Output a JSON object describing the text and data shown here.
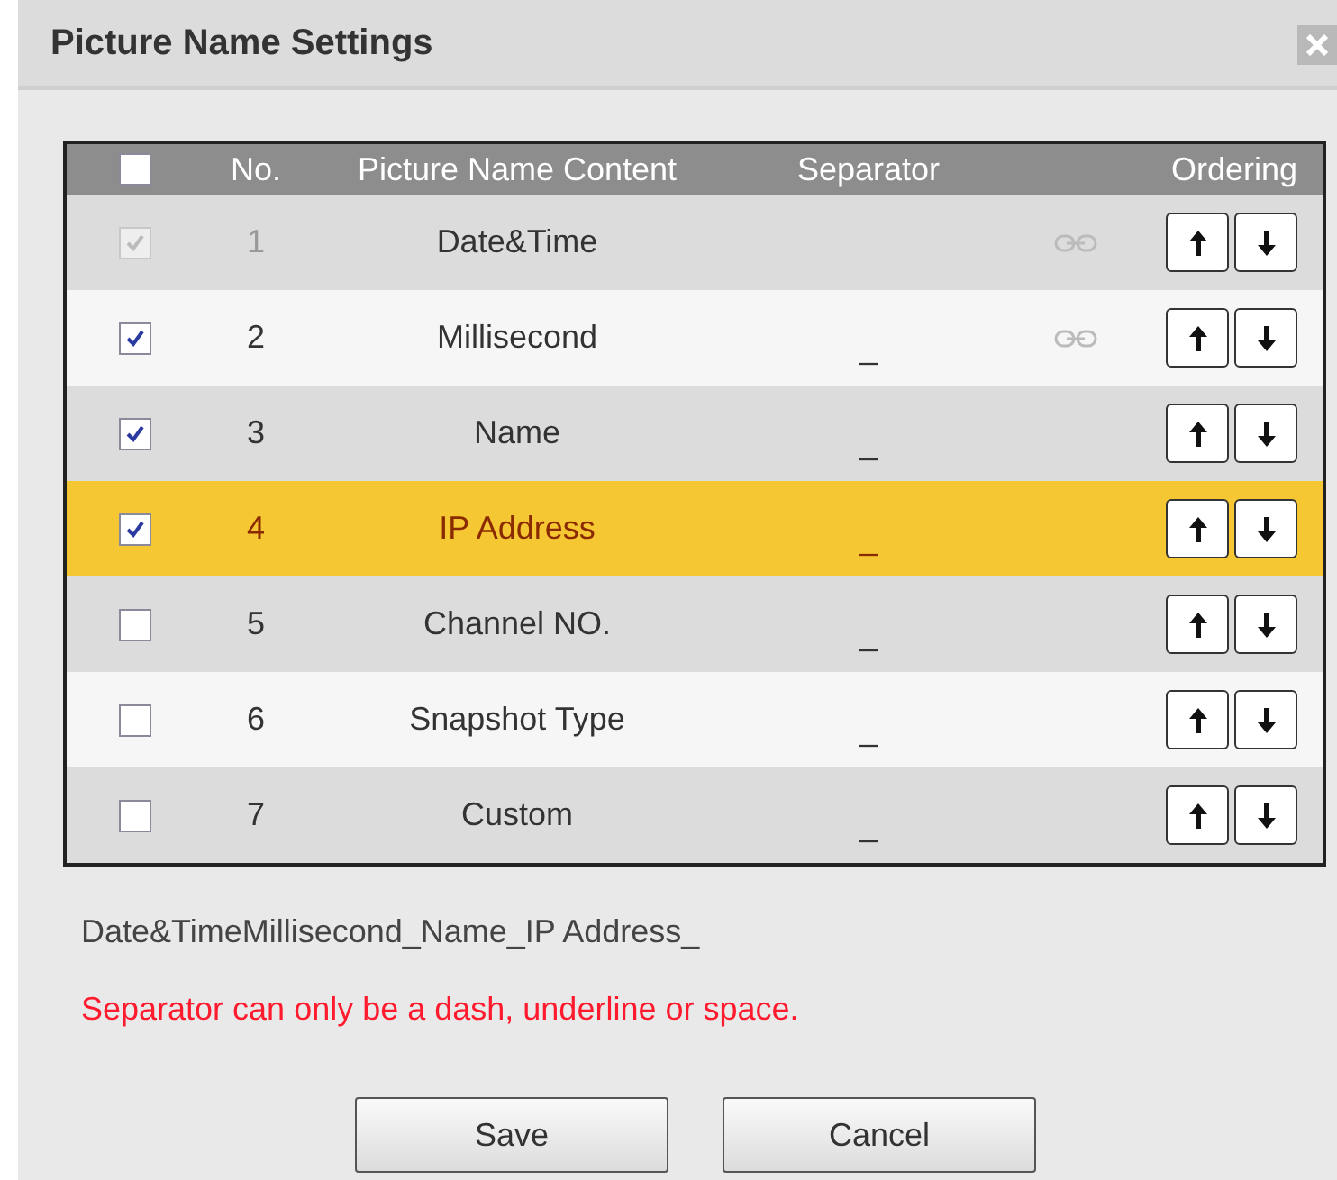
{
  "dialog": {
    "title": "Picture Name Settings"
  },
  "table": {
    "header": {
      "all_checked": false,
      "columns": [
        "No.",
        "Picture Name Content",
        "Separator",
        "Ordering"
      ]
    },
    "rows": [
      {
        "checked": true,
        "disabled": true,
        "no": "1",
        "content": "Date&Time",
        "separator": "",
        "linked": true,
        "selected": false
      },
      {
        "checked": true,
        "disabled": false,
        "no": "2",
        "content": "Millisecond",
        "separator": "_",
        "linked": true,
        "selected": false
      },
      {
        "checked": true,
        "disabled": false,
        "no": "3",
        "content": "Name",
        "separator": "_",
        "linked": false,
        "selected": false
      },
      {
        "checked": true,
        "disabled": false,
        "no": "4",
        "content": "IP Address",
        "separator": "_",
        "linked": false,
        "selected": true
      },
      {
        "checked": false,
        "disabled": false,
        "no": "5",
        "content": "Channel NO.",
        "separator": "_",
        "linked": false,
        "selected": false
      },
      {
        "checked": false,
        "disabled": false,
        "no": "6",
        "content": "Snapshot Type",
        "separator": "_",
        "linked": false,
        "selected": false
      },
      {
        "checked": false,
        "disabled": false,
        "no": "7",
        "content": "Custom",
        "separator": "_",
        "linked": false,
        "selected": false
      }
    ]
  },
  "preview": "Date&TimeMillisecond_Name_IP Address_",
  "warning": "Separator can only be a dash, underline or space.",
  "buttons": [
    "Save",
    "Cancel"
  ]
}
